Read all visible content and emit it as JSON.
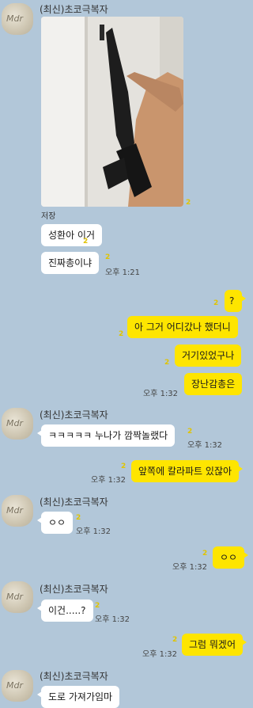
{
  "chat": {
    "sender_name": "(최신)초코극복자",
    "avatar_text": "Mdr",
    "photo_caption": "저장",
    "messages": [
      {
        "text": "성환아 이거",
        "count": "2"
      },
      {
        "text": "진짜총이냐",
        "count": "2",
        "time": "오후 1:21"
      },
      {
        "text": "?",
        "count": "2"
      },
      {
        "text": "아 그거 어디갔나 했더니",
        "count": "2"
      },
      {
        "text": "거기있었구나",
        "count": "2"
      },
      {
        "text": "장난감총은",
        "time": "오후 1:32"
      },
      {
        "text": "ㅋㅋㅋㅋㅋ 누나가 깜짝놀랬다",
        "count": "2",
        "time": "오후 1:32"
      },
      {
        "text": "앞쪽에 칼라파트 있잖아",
        "count": "2",
        "time": "오후 1:32"
      },
      {
        "text": "ㅇㅇ",
        "count": "2",
        "time": "오후 1:32"
      },
      {
        "text": "ㅇㅇ",
        "count": "2",
        "time": "오후 1:32"
      },
      {
        "text": "이건.....?",
        "count": "2",
        "time": "오후 1:32"
      },
      {
        "text": "그럼 뭐겠어",
        "count": "2",
        "time": "오후 1:32"
      },
      {
        "text": "도로 가져가임마"
      }
    ]
  },
  "colors": {
    "background": "#b2c7d9",
    "incoming": "#ffffff",
    "outgoing": "#fee500",
    "unread": "#e0c400"
  }
}
